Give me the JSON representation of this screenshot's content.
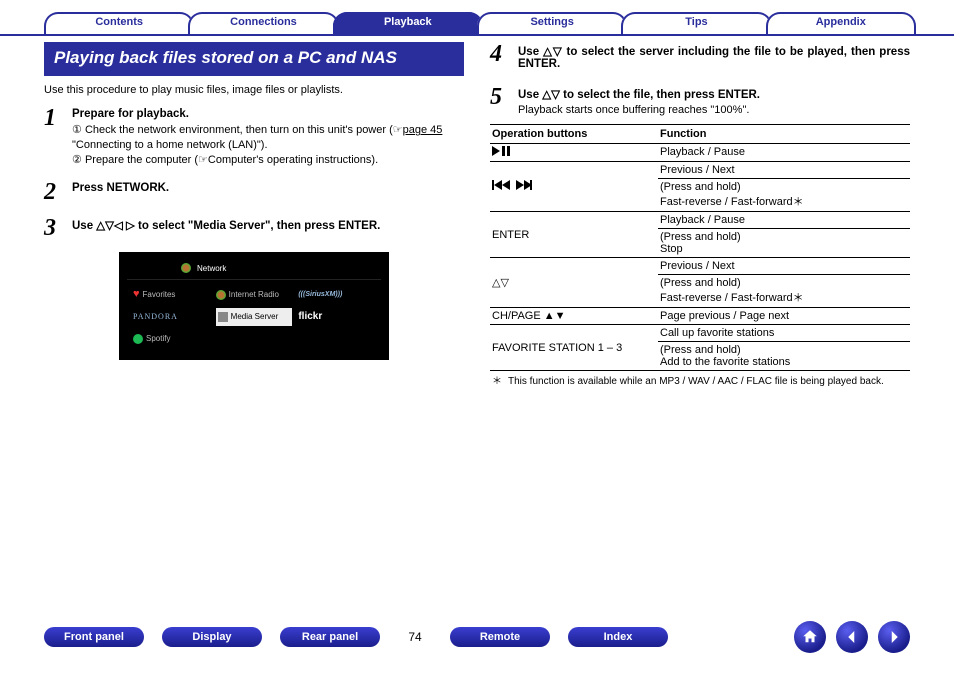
{
  "tabs": {
    "contents": "Contents",
    "connections": "Connections",
    "playback": "Playback",
    "settings": "Settings",
    "tips": "Tips",
    "appendix": "Appendix"
  },
  "section_title": "Playing back files stored on a PC and NAS",
  "intro": "Use this procedure to play music files, image files or playlists.",
  "steps": {
    "s1": {
      "num": "1",
      "head": "Prepare for playback.",
      "line1a": "Check the network environment, then turn on this unit's power (",
      "line1_link": "page 45",
      "line1b": " \"Connecting to a home network (LAN)\").",
      "line2": "Prepare the computer (☞Computer's operating instructions)."
    },
    "s2": {
      "num": "2",
      "head": "Press NETWORK."
    },
    "s3": {
      "num": "3",
      "head": "Use △▽◁ ▷ to select \"Media Server\", then press ENTER."
    },
    "s4": {
      "num": "4",
      "head": "Use △▽ to select the server including the file to be played, then press ENTER."
    },
    "s5": {
      "num": "5",
      "head": "Use △▽ to select the file, then press ENTER.",
      "sub": "Playback starts once buffering reaches \"100%\"."
    }
  },
  "screen": {
    "network": "Network",
    "favorites": "Favorites",
    "internet_radio": "Internet Radio",
    "siriusxm": "SiriusXM",
    "pandora": "PANDORA",
    "media_server": "Media Server",
    "flickr": "flickr",
    "spotify": "Spotify"
  },
  "table": {
    "h1": "Operation buttons",
    "h2": "Function",
    "rows": [
      {
        "btn": "►/❚❚",
        "fn": "Playback / Pause"
      },
      {
        "btn": "",
        "fn": "Previous / Next"
      },
      {
        "btn": "⏮ ⏭",
        "fn": "(Press and hold)\nFast-reverse / Fast-forward＊"
      },
      {
        "btn": "",
        "fn": "Playback / Pause"
      },
      {
        "btn": "ENTER",
        "fn": "(Press and hold)\nStop"
      },
      {
        "btn": "",
        "fn": "Previous / Next"
      },
      {
        "btn": "△▽",
        "fn": "(Press and hold)\nFast-reverse / Fast-forward＊"
      },
      {
        "btn": "CH/PAGE ▲▼",
        "fn": "Page previous / Page next"
      },
      {
        "btn": "",
        "fn": "Call up favorite stations"
      },
      {
        "btn": "FAVORITE STATION 1 – 3",
        "fn": "(Press and hold)\nAdd to the favorite stations"
      }
    ],
    "footnote_sym": "＊",
    "footnote": "This function is available while an MP3 / WAV / AAC / FLAC file is being played back."
  },
  "footer": {
    "front_panel": "Front panel",
    "display": "Display",
    "rear_panel": "Rear panel",
    "page": "74",
    "remote": "Remote",
    "index": "Index"
  }
}
